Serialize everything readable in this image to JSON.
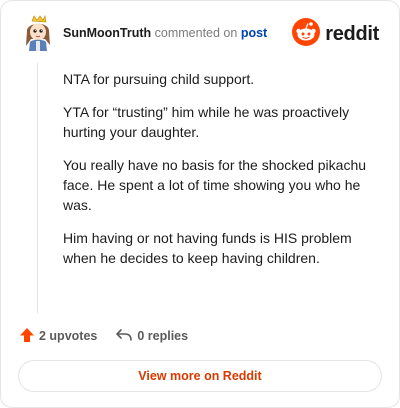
{
  "header": {
    "username": "SunMoonTruth",
    "verb": "commented on",
    "post_link": "post",
    "brand": "reddit"
  },
  "comment": {
    "paragraphs": [
      "NTA for pursuing child support.",
      "YTA for “trusting” him while he was proactively hurting your daughter.",
      "You really have no basis for the shocked pikachu face. He spent a lot of time showing you who he was.",
      "Him having or not having funds is HIS problem when he decides to keep having children."
    ]
  },
  "actions": {
    "upvotes": "2 upvotes",
    "replies": "0 replies"
  },
  "footer": {
    "view_more": "View more on Reddit"
  },
  "colors": {
    "accent": "#d93a00",
    "reddit_orange": "#ff4500",
    "link": "#0045ac"
  },
  "icons": {
    "avatar": "snoo-avatar",
    "brand": "reddit-snoo-icon",
    "upvote": "upvote-arrow-icon",
    "reply": "reply-arrow-icon"
  }
}
